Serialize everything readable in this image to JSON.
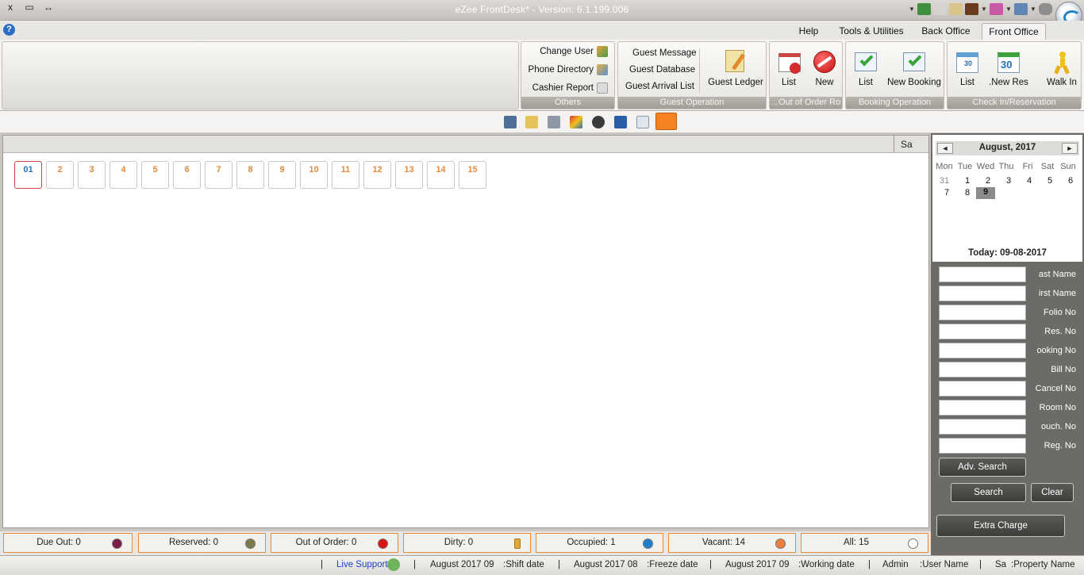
{
  "window": {
    "title": "eZee FrontDesk* - Version: 6.1.199.006",
    "controls": [
      "x",
      "▭",
      "↔"
    ]
  },
  "menu_tabs": [
    {
      "label": "Help",
      "active": false
    },
    {
      "label": "Tools & Utilities",
      "active": false
    },
    {
      "label": "Back Office",
      "active": false
    },
    {
      "label": "Front Office",
      "active": true
    }
  ],
  "ribbon": {
    "others": {
      "label": "Others",
      "items": [
        "Change User",
        "Phone Directory",
        "Cashier Report"
      ]
    },
    "guest_operation": {
      "label": "Guest Operation",
      "items": [
        "Guest Message",
        "Guest Database",
        "Guest Arrival List"
      ],
      "big": "Guest Ledger"
    },
    "out_of_order": {
      "label": "...Out of Order Ro",
      "items": [
        "List",
        "New"
      ]
    },
    "booking_operation": {
      "label": "Booking Operation",
      "items": [
        "List",
        "New Booking"
      ]
    },
    "checkin": {
      "label": "Check In/Reservation",
      "items": [
        "List",
        ".New Res",
        "Walk In"
      ]
    }
  },
  "main": {
    "header_cell": "Sa",
    "rooms": [
      "01",
      "2",
      "3",
      "4",
      "5",
      "6",
      "7",
      "8",
      "9",
      "10",
      "11",
      "12",
      "13",
      "14",
      "15"
    ]
  },
  "calendar": {
    "month": "August, 2017",
    "prev": "◄",
    "next": "►",
    "dows": [
      "Mon",
      "Tue",
      "Wed",
      "Thu",
      "Fri",
      "Sat",
      "Sun"
    ],
    "week1": [
      "31",
      "1",
      "2",
      "3",
      "4",
      "5",
      "6"
    ],
    "week2": [
      "7",
      "8",
      "9"
    ],
    "today_label": "Today: 09-08-2017"
  },
  "search": {
    "fields": [
      "ast Name",
      "irst Name",
      "Folio No",
      "Res. No",
      "ooking No",
      "Bill No",
      "Cancel No",
      "Room No",
      "ouch. No",
      "Reg. No"
    ],
    "adv_search": "Adv. Search",
    "search": "Search",
    "clear": "Clear",
    "extra_charge": "Extra Charge"
  },
  "legend": [
    {
      "label": "Due Out: 0",
      "color": "#7a1b4a"
    },
    {
      "label": "Reserved: 0",
      "color": "#7a7a4a"
    },
    {
      "label": "Out of Order: 0",
      "color": "#d81818"
    },
    {
      "label": "Dirty: 0",
      "color": "broom"
    },
    {
      "label": "Occupied: 1",
      "color": "#1e7fc9"
    },
    {
      "label": "Vacant: 14",
      "color": "#ee7e3f"
    },
    {
      "label": "All: 15",
      "color": "#ffffff"
    }
  ],
  "status": {
    "sep": "|",
    "live_support": "Live Support",
    "shift_date": "August 2017 09",
    "shift_label": ":Shift date",
    "freeze_date": "August 2017 08",
    "freeze_label": ":Freeze date",
    "working_date": "August 2017 09",
    "working_label": ":Working date",
    "user": "Admin",
    "user_label": ":User Name",
    "property": "Sa",
    "property_label": ":Property Name"
  }
}
